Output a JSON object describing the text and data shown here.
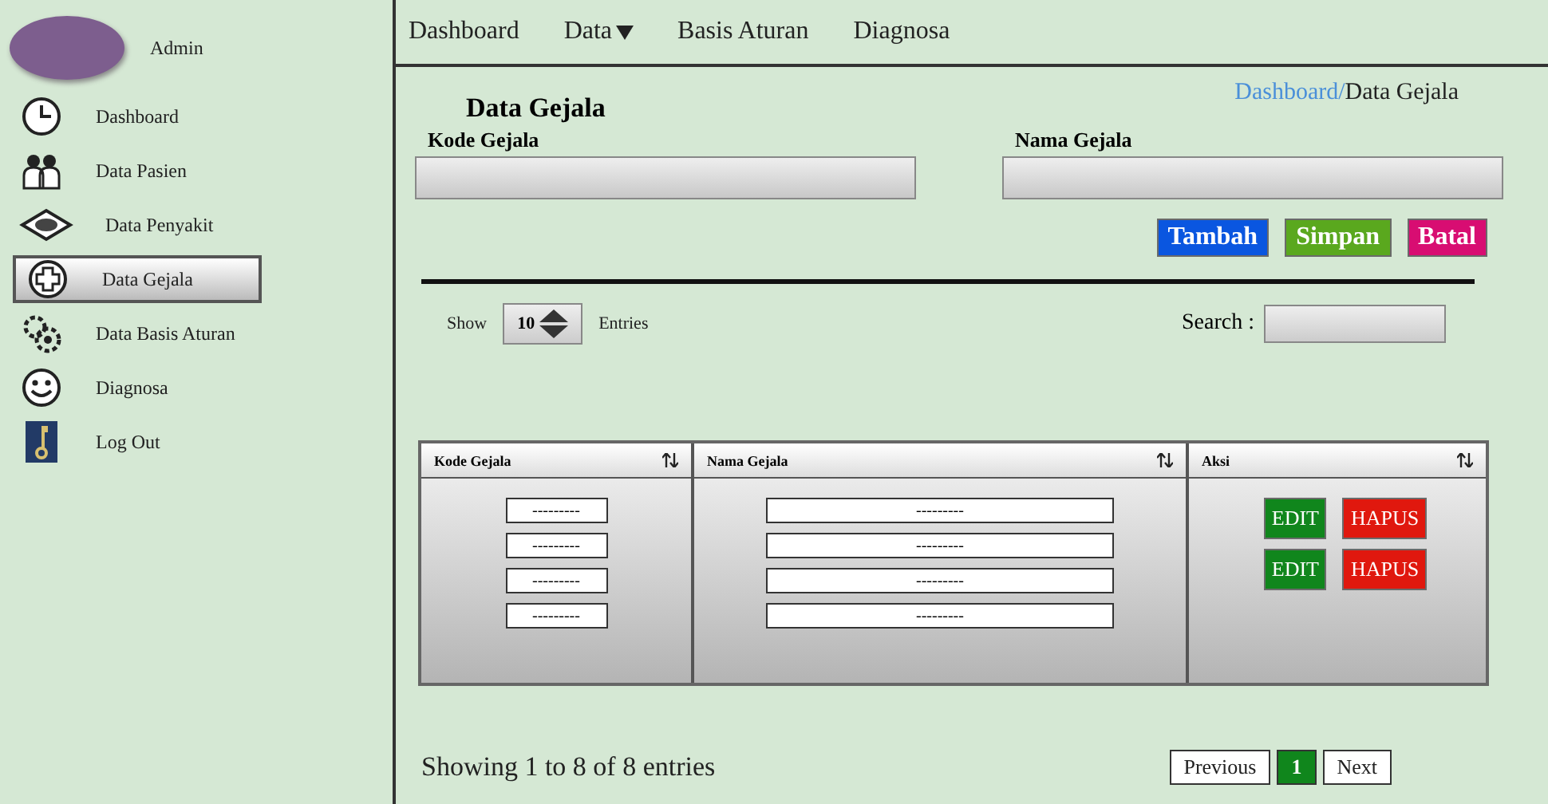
{
  "user": {
    "name": "Admin"
  },
  "sidebar": {
    "items": [
      {
        "label": "Dashboard",
        "selected": false
      },
      {
        "label": "Data Pasien",
        "selected": false
      },
      {
        "label": "Data Penyakit",
        "selected": false
      },
      {
        "label": "Data Gejala",
        "selected": true
      },
      {
        "label": "Data Basis Aturan",
        "selected": false
      },
      {
        "label": "Diagnosa",
        "selected": false
      },
      {
        "label": "Log Out",
        "selected": false
      }
    ]
  },
  "nav": [
    {
      "label": "Dashboard",
      "dropdown": false
    },
    {
      "label": "Data",
      "dropdown": true
    },
    {
      "label": "Basis Aturan",
      "dropdown": false
    },
    {
      "label": "Diagnosa",
      "dropdown": false
    }
  ],
  "page_title": "Data Gejala",
  "breadcrumb": {
    "link": "Dashboard",
    "separator": "/",
    "current": "Data Gejala"
  },
  "form": {
    "fields": [
      {
        "label": "Kode Gejala"
      },
      {
        "label": "Nama Gejala"
      }
    ],
    "buttons": [
      {
        "label": "Tambah",
        "kind": "add"
      },
      {
        "label": "Simpan",
        "kind": "save"
      },
      {
        "label": "Batal",
        "kind": "cancel"
      }
    ]
  },
  "length": {
    "show": "Show",
    "value": "10",
    "entries": "Entries"
  },
  "search": {
    "label": "Search :"
  },
  "table": {
    "columns": [
      "Kode Gejala",
      "Nama Gejala",
      "Aksi"
    ],
    "rows": [
      {
        "kode": "---------",
        "nama": "---------",
        "actions": [
          {
            "label": "EDIT",
            "kind": "edit"
          },
          {
            "label": "HAPUS",
            "kind": "delete"
          }
        ]
      },
      {
        "kode": "---------",
        "nama": "---------",
        "actions": [
          {
            "label": "EDIT",
            "kind": "edit"
          },
          {
            "label": "HAPUS",
            "kind": "delete"
          }
        ]
      },
      {
        "kode": "---------",
        "nama": "---------"
      },
      {
        "kode": "---------",
        "nama": "---------"
      }
    ]
  },
  "info": "Showing 1 to 8 of 8 entries",
  "pagination": [
    {
      "label": "Previous",
      "selected": false
    },
    {
      "label": "1",
      "selected": true
    },
    {
      "label": "Next",
      "selected": false
    }
  ]
}
